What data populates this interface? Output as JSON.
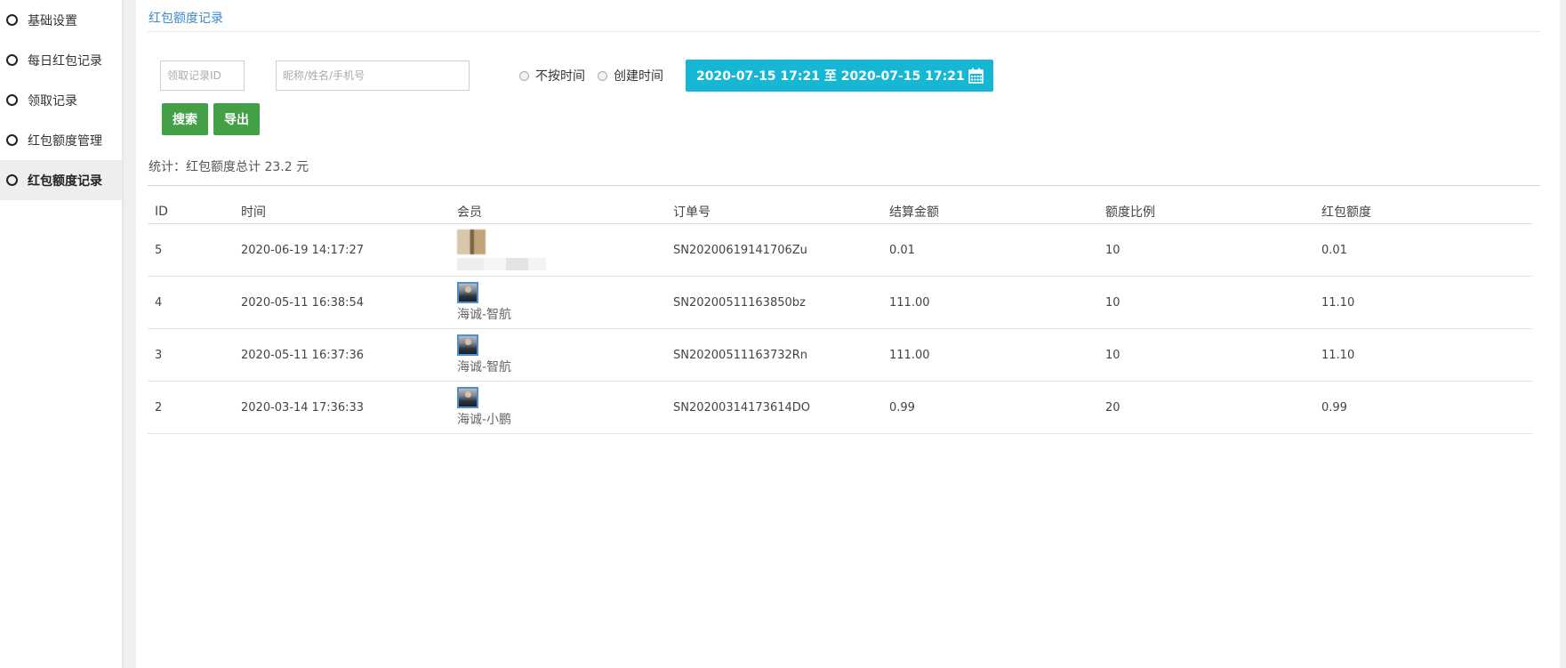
{
  "sidebar": {
    "items": [
      {
        "label": "基础设置",
        "active": false
      },
      {
        "label": "每日红包记录",
        "active": false
      },
      {
        "label": "领取记录",
        "active": false
      },
      {
        "label": "红包额度管理",
        "active": false
      },
      {
        "label": "红包额度记录",
        "active": true
      }
    ]
  },
  "page": {
    "title": "红包额度记录"
  },
  "filters": {
    "record_id_placeholder": "领取记录ID",
    "keyword_placeholder": "昵称/姓名/手机号",
    "radio_options": [
      "不按时间",
      "创建时间"
    ],
    "date_range": "2020-07-15 17:21 至 2020-07-15 17:21",
    "calendar_icon": "calendar-icon"
  },
  "buttons": {
    "search": "搜索",
    "export": "导出"
  },
  "stats": {
    "text": "统计：红包额度总计 23.2 元"
  },
  "table": {
    "headers": [
      "ID",
      "时间",
      "会员",
      "订单号",
      "结算金额",
      "额度比例",
      "红包额度"
    ],
    "rows": [
      {
        "id": "5",
        "time": "2020-06-19 14:17:27",
        "member": "",
        "order": "SN20200619141706Zu",
        "amount": "0.01",
        "ratio": "10",
        "quota": "0.01"
      },
      {
        "id": "4",
        "time": "2020-05-11 16:38:54",
        "member": "海诚-智航",
        "order": "SN20200511163850bz",
        "amount": "111.00",
        "ratio": "10",
        "quota": "11.10"
      },
      {
        "id": "3",
        "time": "2020-05-11 16:37:36",
        "member": "海诚-智航",
        "order": "SN20200511163732Rn",
        "amount": "111.00",
        "ratio": "10",
        "quota": "11.10"
      },
      {
        "id": "2",
        "time": "2020-03-14 17:36:33",
        "member": "海诚-小鹏",
        "order": "SN20200314173614DO",
        "amount": "0.99",
        "ratio": "20",
        "quota": "0.99"
      }
    ]
  },
  "colors": {
    "accent": "#16b7d4",
    "button": "#43a047",
    "title": "#3f8ac6"
  }
}
